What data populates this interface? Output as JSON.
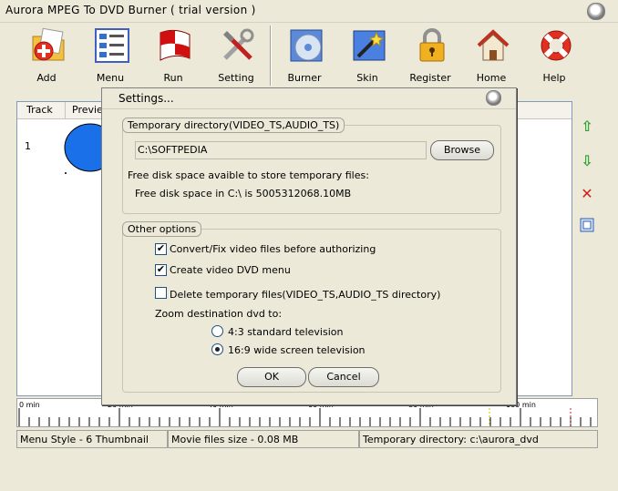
{
  "window": {
    "title": "Aurora MPEG To DVD Burner  ( trial version )"
  },
  "toolbar": [
    {
      "label": "Add",
      "icon": "add-folder-icon"
    },
    {
      "label": "Menu",
      "icon": "menu-icon"
    },
    {
      "label": "Run",
      "icon": "run-flag-icon"
    },
    {
      "label": "Setting",
      "icon": "tools-icon"
    },
    {
      "label": "Burner",
      "icon": "disc-icon"
    },
    {
      "label": "Skin",
      "icon": "magic-wand-icon"
    },
    {
      "label": "Register",
      "icon": "padlock-icon"
    },
    {
      "label": "Home",
      "icon": "home-icon"
    },
    {
      "label": "Help",
      "icon": "lifebuoy-icon"
    }
  ],
  "grid": {
    "headers": [
      "Track",
      "Preview"
    ],
    "rows": [
      {
        "track": "1"
      }
    ]
  },
  "timeline": {
    "labels": [
      "0 min",
      "20 min",
      "40 min",
      "60 min",
      "80 min",
      "100 min"
    ]
  },
  "status": {
    "menu_style": "Menu Style - 6 Thumbnail",
    "files_size": "Movie files size - 0.08 MB",
    "temp_dir": "Temporary directory: c:\\aurora_dvd"
  },
  "dialog": {
    "title": "Settings...",
    "temp_group": "Temporary directory(VIDEO_TS,AUDIO_TS)",
    "path_value": "C:\\SOFTPEDIA",
    "browse_label": "Browse",
    "free_space_label": "Free disk space avaible to store temporary files:",
    "free_space_value": "Free disk space in C:\\ is 5005312068.10MB",
    "other_group": "Other options",
    "opt_convert": "Convert/Fix video files before authorizing",
    "opt_menu": "Create video DVD menu",
    "opt_delete": "Delete temporary files(VIDEO_TS,AUDIO_TS directory)",
    "zoom_label": "Zoom destination dvd to:",
    "zoom_43": "4:3 standard television",
    "zoom_169": "16:9 wide screen television",
    "ok_label": "OK",
    "cancel_label": "Cancel",
    "checked": {
      "convert": true,
      "menu": true,
      "delete": false
    },
    "zoom_selected": "16:9"
  }
}
